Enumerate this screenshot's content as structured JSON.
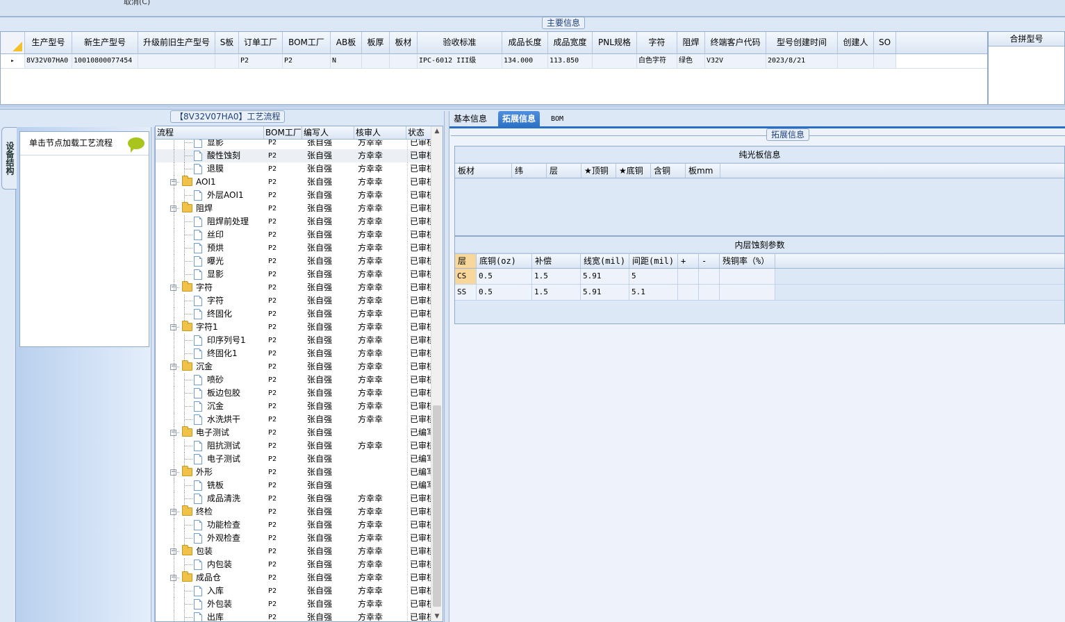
{
  "top": {
    "cutoff_text": "取消(C)"
  },
  "main": {
    "title": "主要信息",
    "columns": [
      "生产型号",
      "新生产型号",
      "升级前旧生产型号",
      "S板",
      "订单工厂",
      "BOM工厂",
      "AB板",
      "板厚",
      "板材",
      "验收标准",
      "成品长度",
      "成品宽度",
      "PNL规格",
      "字符",
      "阻焊",
      "终端客户代码",
      "型号创建时间",
      "创建人",
      "SO"
    ],
    "row": [
      "8V32V07HA0",
      "10010800077454",
      "",
      "",
      "P2",
      "P2",
      "N",
      "",
      "",
      "IPC-6012 III级",
      "134.000",
      "113.850",
      "",
      "白色字符",
      "绿色",
      "V32V",
      "2023/8/21",
      "",
      ""
    ],
    "row_indicator": "▸",
    "merge_title": "合拼型号"
  },
  "left": {
    "tab_label": "设备结构",
    "load_hint": "单击节点加载工艺流程"
  },
  "flow": {
    "title": "【8V32V07HA0】工艺流程",
    "columns": [
      "流程",
      "BOM工厂",
      "编写人",
      "核审人",
      "状态"
    ],
    "rows": [
      {
        "level": 1,
        "type": "doc",
        "name": "显影",
        "bom": "P2",
        "writer": "张自强",
        "reviewer": "方幸幸",
        "status": "已审核"
      },
      {
        "level": 1,
        "type": "doc",
        "name": "酸性蚀刻",
        "bom": "P2",
        "writer": "张自强",
        "reviewer": "方幸幸",
        "status": "已审核",
        "selected": true
      },
      {
        "level": 1,
        "type": "doc",
        "name": "退膜",
        "bom": "P2",
        "writer": "张自强",
        "reviewer": "方幸幸",
        "status": "已审核"
      },
      {
        "level": 0,
        "type": "folder",
        "name": "AOI1",
        "bom": "P2",
        "writer": "张自强",
        "reviewer": "方幸幸",
        "status": "已审核"
      },
      {
        "level": 1,
        "type": "doc",
        "name": "外层AOI1",
        "bom": "P2",
        "writer": "张自强",
        "reviewer": "方幸幸",
        "status": "已审核"
      },
      {
        "level": 0,
        "type": "folder",
        "name": "阻焊",
        "bom": "P2",
        "writer": "张自强",
        "reviewer": "方幸幸",
        "status": "已审核"
      },
      {
        "level": 1,
        "type": "doc",
        "name": "阻焊前处理",
        "bom": "P2",
        "writer": "张自强",
        "reviewer": "方幸幸",
        "status": "已审核"
      },
      {
        "level": 1,
        "type": "doc",
        "name": "丝印",
        "bom": "P2",
        "writer": "张自强",
        "reviewer": "方幸幸",
        "status": "已审核"
      },
      {
        "level": 1,
        "type": "doc",
        "name": "预烘",
        "bom": "P2",
        "writer": "张自强",
        "reviewer": "方幸幸",
        "status": "已审核"
      },
      {
        "level": 1,
        "type": "doc",
        "name": "曝光",
        "bom": "P2",
        "writer": "张自强",
        "reviewer": "方幸幸",
        "status": "已审核"
      },
      {
        "level": 1,
        "type": "doc",
        "name": "显影",
        "bom": "P2",
        "writer": "张自强",
        "reviewer": "方幸幸",
        "status": "已审核"
      },
      {
        "level": 0,
        "type": "folder",
        "name": "字符",
        "bom": "P2",
        "writer": "张自强",
        "reviewer": "方幸幸",
        "status": "已审核"
      },
      {
        "level": 1,
        "type": "doc",
        "name": "字符",
        "bom": "P2",
        "writer": "张自强",
        "reviewer": "方幸幸",
        "status": "已审核"
      },
      {
        "level": 1,
        "type": "doc",
        "name": "终固化",
        "bom": "P2",
        "writer": "张自强",
        "reviewer": "方幸幸",
        "status": "已审核"
      },
      {
        "level": 0,
        "type": "folder",
        "name": "字符1",
        "bom": "P2",
        "writer": "张自强",
        "reviewer": "方幸幸",
        "status": "已审核"
      },
      {
        "level": 1,
        "type": "doc",
        "name": "印序列号1",
        "bom": "P2",
        "writer": "张自强",
        "reviewer": "方幸幸",
        "status": "已审核"
      },
      {
        "level": 1,
        "type": "doc",
        "name": "终固化1",
        "bom": "P2",
        "writer": "张自强",
        "reviewer": "方幸幸",
        "status": "已审核"
      },
      {
        "level": 0,
        "type": "folder",
        "name": "沉金",
        "bom": "P2",
        "writer": "张自强",
        "reviewer": "方幸幸",
        "status": "已审核"
      },
      {
        "level": 1,
        "type": "doc",
        "name": "喷砂",
        "bom": "P2",
        "writer": "张自强",
        "reviewer": "方幸幸",
        "status": "已审核"
      },
      {
        "level": 1,
        "type": "doc",
        "name": "板边包胶",
        "bom": "P2",
        "writer": "张自强",
        "reviewer": "方幸幸",
        "status": "已审核"
      },
      {
        "level": 1,
        "type": "doc",
        "name": "沉金",
        "bom": "P2",
        "writer": "张自强",
        "reviewer": "方幸幸",
        "status": "已审核"
      },
      {
        "level": 1,
        "type": "doc",
        "name": "水洗烘干",
        "bom": "P2",
        "writer": "张自强",
        "reviewer": "方幸幸",
        "status": "已审核"
      },
      {
        "level": 0,
        "type": "folder",
        "name": "电子测试",
        "bom": "P2",
        "writer": "张自强",
        "reviewer": "",
        "status": "已编写"
      },
      {
        "level": 1,
        "type": "doc",
        "name": "阻抗测试",
        "bom": "P2",
        "writer": "张自强",
        "reviewer": "方幸幸",
        "status": "已审核"
      },
      {
        "level": 1,
        "type": "doc",
        "name": "电子测试",
        "bom": "P2",
        "writer": "张自强",
        "reviewer": "",
        "status": "已编写"
      },
      {
        "level": 0,
        "type": "folder",
        "name": "外形",
        "bom": "P2",
        "writer": "张自强",
        "reviewer": "",
        "status": "已编写"
      },
      {
        "level": 1,
        "type": "doc",
        "name": "铣板",
        "bom": "P2",
        "writer": "张自强",
        "reviewer": "",
        "status": "已编写"
      },
      {
        "level": 1,
        "type": "doc",
        "name": "成品清洗",
        "bom": "P2",
        "writer": "张自强",
        "reviewer": "方幸幸",
        "status": "已审核"
      },
      {
        "level": 0,
        "type": "folder",
        "name": "终检",
        "bom": "P2",
        "writer": "张自强",
        "reviewer": "方幸幸",
        "status": "已审核"
      },
      {
        "level": 1,
        "type": "doc",
        "name": "功能检查",
        "bom": "P2",
        "writer": "张自强",
        "reviewer": "方幸幸",
        "status": "已审核"
      },
      {
        "level": 1,
        "type": "doc",
        "name": "外观检查",
        "bom": "P2",
        "writer": "张自强",
        "reviewer": "方幸幸",
        "status": "已审核"
      },
      {
        "level": 0,
        "type": "folder",
        "name": "包装",
        "bom": "P2",
        "writer": "张自强",
        "reviewer": "方幸幸",
        "status": "已审核"
      },
      {
        "level": 1,
        "type": "doc",
        "name": "内包装",
        "bom": "P2",
        "writer": "张自强",
        "reviewer": "方幸幸",
        "status": "已审核"
      },
      {
        "level": 0,
        "type": "folder",
        "name": "成品仓",
        "bom": "P2",
        "writer": "张自强",
        "reviewer": "方幸幸",
        "status": "已审核"
      },
      {
        "level": 1,
        "type": "doc",
        "name": "入库",
        "bom": "P2",
        "writer": "张自强",
        "reviewer": "方幸幸",
        "status": "已审核"
      },
      {
        "level": 1,
        "type": "doc",
        "name": "外包装",
        "bom": "P2",
        "writer": "张自强",
        "reviewer": "方幸幸",
        "status": "已审核"
      },
      {
        "level": 1,
        "type": "doc",
        "name": "出库",
        "bom": "P2",
        "writer": "张自强",
        "reviewer": "方幸幸",
        "status": "已审核"
      }
    ]
  },
  "tabs": [
    {
      "label": "基本信息",
      "active": false
    },
    {
      "label": "拓展信息",
      "active": true
    },
    {
      "label": "BOM",
      "active": false
    }
  ],
  "ext": {
    "title": "拓展信息",
    "pure": {
      "title": "纯光板信息",
      "columns": [
        "板材",
        "纬",
        "层",
        "★顶铜",
        "★底铜",
        "含铜",
        "板mm"
      ]
    },
    "inner": {
      "title": "内层蚀刻参数",
      "columns": [
        "层",
        "底铜(oz)",
        "补偿",
        "线宽(mil)",
        "间距(mil)",
        "+",
        "-",
        "残铜率（%）"
      ],
      "rows": [
        [
          "CS",
          "0.5",
          "1.5",
          "5.91",
          "5",
          "",
          "",
          ""
        ],
        [
          "SS",
          "0.5",
          "1.5",
          "5.91",
          "5.1",
          "",
          "",
          ""
        ]
      ]
    }
  },
  "colors": {
    "accent": "#2b6fc4",
    "corner": "#f5c12a",
    "folder": "#f1c24a",
    "chat": "#a8c41d",
    "highlight": "#f7d79a"
  }
}
